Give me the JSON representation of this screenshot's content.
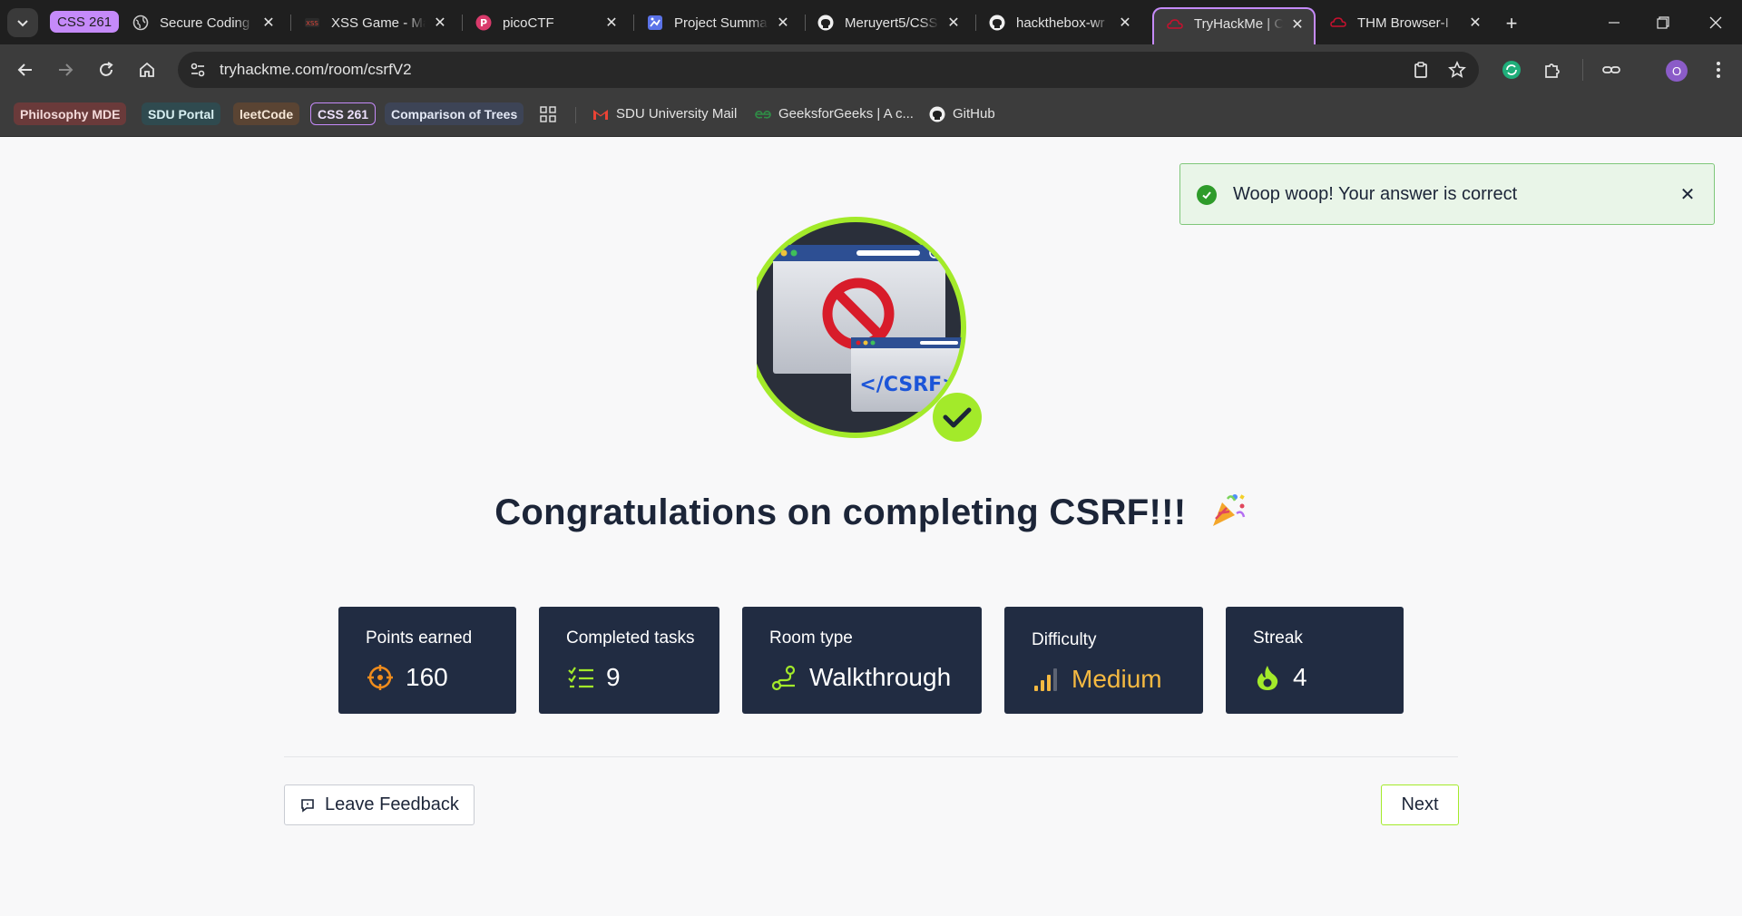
{
  "browser": {
    "tab_group_label": "CSS 261",
    "tabs": [
      {
        "title": "Secure Coding",
        "icon": "globe-icon"
      },
      {
        "title": "XSS Game - Ma",
        "icon": "xss-game-icon"
      },
      {
        "title": "picoCTF",
        "icon": "picoctf-icon"
      },
      {
        "title": "Project Summa",
        "icon": "project-icon"
      },
      {
        "title": "Meruyert5/CSS",
        "icon": "github-icon"
      },
      {
        "title": "hackthebox-wr",
        "icon": "github-icon"
      },
      {
        "title": "TryHackMe | CS",
        "icon": "tryhackme-icon"
      },
      {
        "title": "THM Browser-I",
        "icon": "tryhackme-icon"
      }
    ],
    "url": "tryhackme.com/room/csrfV2",
    "profile_initial": "O",
    "bookmarks": {
      "chips": [
        "Philosophy MDE",
        "SDU Portal",
        "leetCode",
        "CSS 261",
        "Comparison of Trees"
      ],
      "links": [
        "SDU University Mail",
        "GeeksforGeeks | A c...",
        "GitHub"
      ]
    }
  },
  "toast": {
    "message": "Woop woop! Your answer is correct"
  },
  "badge": {
    "code_label": "</CSRF>"
  },
  "page": {
    "title": "Congratulations on completing CSRF!!!",
    "stats": [
      {
        "label": "Points earned",
        "value": "160",
        "icon": "target-icon"
      },
      {
        "label": "Completed tasks",
        "value": "9",
        "icon": "checklist-icon"
      },
      {
        "label": "Room type",
        "value": "Walkthrough",
        "icon": "route-icon"
      },
      {
        "label": "Difficulty",
        "value": "Medium",
        "icon": "signal-bars-icon"
      },
      {
        "label": "Streak",
        "value": "4",
        "icon": "flame-icon"
      }
    ],
    "feedback_label": "Leave Feedback",
    "next_label": "Next"
  },
  "colors": {
    "accent_green": "#a3ea2a",
    "card_bg": "#212c42",
    "difficulty_medium": "#f5b941",
    "points_icon": "#f08c1c"
  }
}
